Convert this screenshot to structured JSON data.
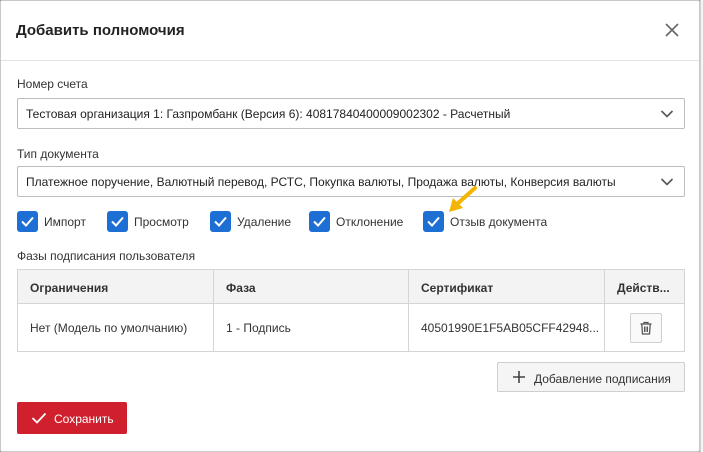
{
  "dialog": {
    "title": "Добавить полномочия"
  },
  "account": {
    "label": "Номер счета",
    "value": "Тестовая организация 1: Газпромбанк (Версия 6): 40817840400009002302 - Расчетный"
  },
  "doc_type": {
    "label": "Тип документа",
    "value": "Платежное поручение, Валютный перевод, РСТС, Покупка валюты, Продажа валюты, Конверсия валюты"
  },
  "permissions": [
    {
      "label": "Импорт",
      "checked": true
    },
    {
      "label": "Просмотр",
      "checked": true
    },
    {
      "label": "Удаление",
      "checked": true
    },
    {
      "label": "Отклонение",
      "checked": true
    },
    {
      "label": "Отзыв документа",
      "checked": true
    }
  ],
  "phases": {
    "label": "Фазы подписания пользователя",
    "columns": [
      "Ограничения",
      "Фаза",
      "Сертификат",
      "Действ..."
    ],
    "rows": [
      [
        "Нет (Модель по умолчанию)",
        "1 - Подпись",
        "40501990E1F5AB05CFF42948..."
      ]
    ]
  },
  "buttons": {
    "add_signer": "Добавление подписания",
    "save": "Сохранить"
  },
  "colors": {
    "accent": "#1d6fd3",
    "primary_button": "#d0202e",
    "annotation_arrow": "#f4b400"
  }
}
